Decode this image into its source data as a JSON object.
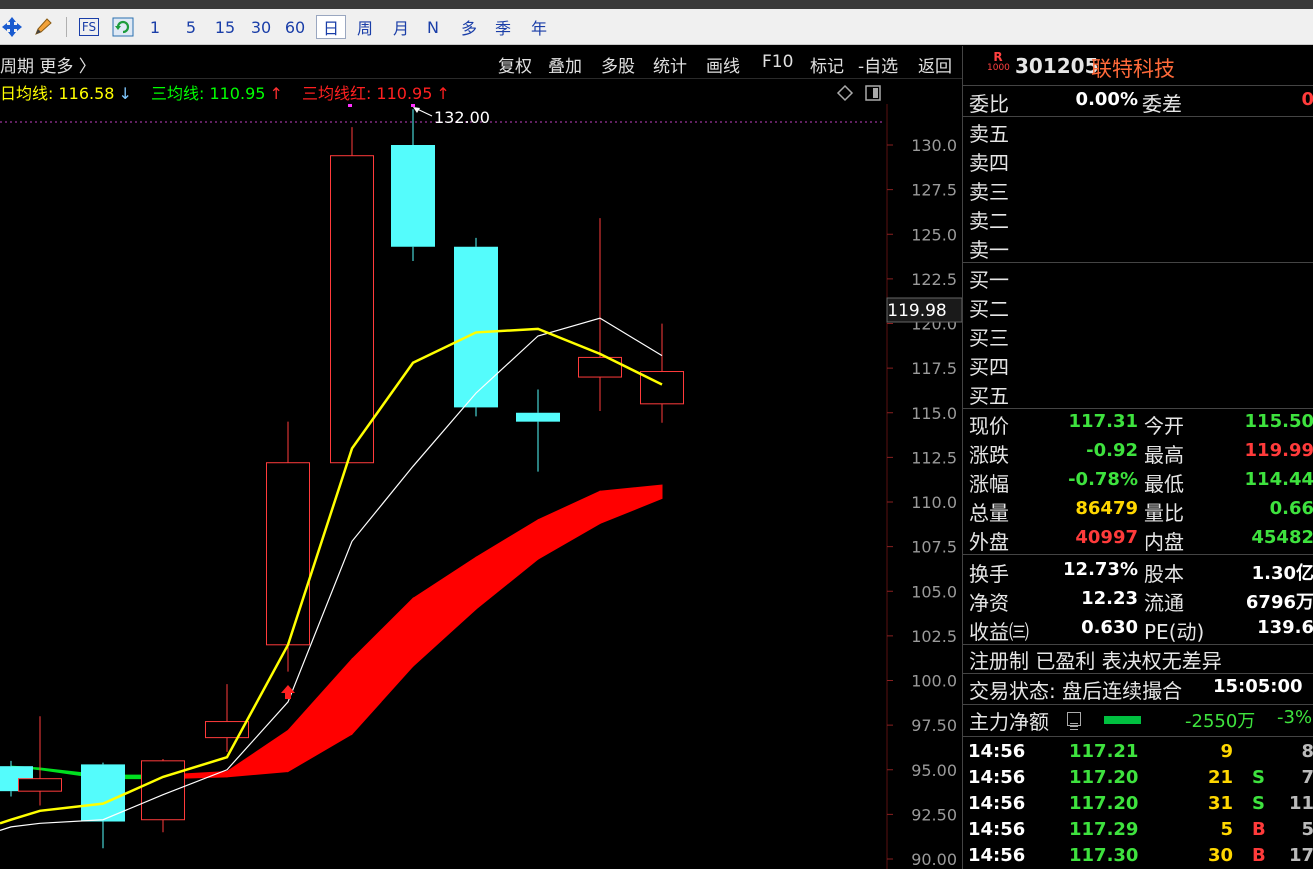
{
  "toolbar": {
    "periods": [
      "1",
      "5",
      "15",
      "30",
      "60",
      "日",
      "周",
      "月",
      "N",
      "多",
      "季",
      "年"
    ],
    "active_period": "日",
    "fs_label": "FS"
  },
  "chart_header": {
    "left_label": "周期  更多 〉",
    "menu": [
      "复权",
      "叠加",
      "多股",
      "统计",
      "画线",
      "F10",
      "标记",
      "-自选",
      "返回"
    ]
  },
  "legend": {
    "ma5": "日均线: 116.58",
    "ma5_arrow": "↓",
    "ma3": "三均线: 110.95",
    "ma3_arrow": "↑",
    "ma3_red": "三均线红: 110.95",
    "ma3_red_arrow": "↑",
    "ma5_color": "#ffff00",
    "ma3_color": "#00ff00",
    "ma3_red_color": "#ff2020"
  },
  "chart_data": {
    "type": "candlestick",
    "y_axis_ticks": [
      "130.0",
      "127.5",
      "125.0",
      "122.5",
      "120.0",
      "117.5",
      "115.0",
      "112.5",
      "110.0",
      "107.5",
      "105.0",
      "102.5",
      "100.0",
      "97.50",
      "95.00",
      "92.50",
      "90.00"
    ],
    "ylim": [
      90,
      132.5
    ],
    "current_price_label": "119.98",
    "high_marker_label": "132.00",
    "candles": [
      {
        "open": 95.2,
        "high": 95.5,
        "low": 93.5,
        "close": 93.8
      },
      {
        "open": 93.8,
        "high": 98.0,
        "low": 93.0,
        "close": 94.5
      },
      {
        "open": 95.3,
        "high": 95.4,
        "low": 90.6,
        "close": 92.1
      },
      {
        "open": 92.2,
        "high": 95.6,
        "low": 91.5,
        "close": 95.5
      },
      {
        "open": 96.8,
        "high": 99.8,
        "low": 96.0,
        "close": 97.7
      },
      {
        "open": 102.0,
        "high": 114.5,
        "low": 100.5,
        "close": 112.2
      },
      {
        "open": 112.2,
        "high": 131.0,
        "low": 112.2,
        "close": 129.4
      },
      {
        "open": 130.0,
        "high": 132.0,
        "low": 123.5,
        "close": 124.3
      },
      {
        "open": 124.3,
        "high": 124.8,
        "low": 114.8,
        "close": 115.3
      },
      {
        "open": 115.0,
        "high": 116.3,
        "low": 111.7,
        "close": 114.5
      },
      {
        "open": 117.0,
        "high": 125.9,
        "low": 115.1,
        "close": 118.1
      },
      {
        "open": 115.5,
        "high": 119.99,
        "low": 114.44,
        "close": 117.31
      }
    ],
    "ma_yellow": [
      92.2,
      92.7,
      93.1,
      94.6,
      95.7,
      102.0,
      113.0,
      117.8,
      119.5,
      119.7,
      118.3,
      116.58
    ],
    "ma_white": [
      91.8,
      92.0,
      92.2,
      93.6,
      95.0,
      98.8,
      107.8,
      112.0,
      116.1,
      119.3,
      120.3,
      118.2
    ],
    "band_upper": [
      95.2,
      95.1,
      94.7,
      94.7,
      94.9,
      97.2,
      101.2,
      104.6,
      106.9,
      109.0,
      110.6,
      110.95
    ],
    "band_lower": [
      95.2,
      95.0,
      94.5,
      94.5,
      94.6,
      94.9,
      97.0,
      100.8,
      104.0,
      106.8,
      108.8,
      110.2
    ],
    "band_colors": [
      "green",
      "green",
      "green",
      "red",
      "red",
      "red",
      "red",
      "red",
      "red",
      "red",
      "red",
      "red"
    ],
    "grid": false
  },
  "stock": {
    "code": "301205",
    "name": "联特科技",
    "badge_top": "R",
    "badge_bottom": "1000"
  },
  "quote": {
    "weibi_label": "委比",
    "weibi_value": "0.00%",
    "weicha_label": "委差",
    "weicha_value": "0",
    "sell_levels": [
      "卖五",
      "卖四",
      "卖三",
      "卖二",
      "卖一"
    ],
    "buy_levels": [
      "买一",
      "买二",
      "买三",
      "买四",
      "买五"
    ],
    "rows": [
      {
        "l1": "现价",
        "v1": "117.31",
        "c1": "green",
        "l2": "今开",
        "v2": "115.50",
        "c2": "green"
      },
      {
        "l1": "涨跌",
        "v1": "-0.92",
        "c1": "green",
        "l2": "最高",
        "v2": "119.99",
        "c2": "red"
      },
      {
        "l1": "涨幅",
        "v1": "-0.78%",
        "c1": "green",
        "l2": "最低",
        "v2": "114.44",
        "c2": "green"
      },
      {
        "l1": "总量",
        "v1": "86479",
        "c1": "yellow",
        "l2": "量比",
        "v2": "0.66",
        "c2": "green"
      },
      {
        "l1": "外盘",
        "v1": "40997",
        "c1": "red",
        "l2": "内盘",
        "v2": "45482",
        "c2": "green"
      },
      {
        "l1": "换手",
        "v1": "12.73%",
        "c1": "white",
        "l2": "股本",
        "v2": "1.30亿",
        "c2": "white"
      },
      {
        "l1": "净资",
        "v1": "12.23",
        "c1": "white",
        "l2": "流通",
        "v2": "6796万",
        "c2": "white"
      },
      {
        "l1": "收益㈢",
        "v1": "0.630",
        "c1": "white",
        "l2": "PE(动)",
        "v2": "139.6",
        "c2": "white"
      }
    ],
    "registration_line": "注册制 已盈利 表决权无差异",
    "trade_status_label": "交易状态: 盘后连续撮合",
    "trade_status_time": "15:05:00",
    "main_flow_label": "主力净额",
    "main_flow_value": "-2550万",
    "main_flow_pct": "-3%"
  },
  "ticks": [
    {
      "time": "14:56",
      "price": "117.21",
      "vol": "9",
      "bs": "",
      "num": "8"
    },
    {
      "time": "14:56",
      "price": "117.20",
      "vol": "21",
      "bs": "S",
      "num": "7"
    },
    {
      "time": "14:56",
      "price": "117.20",
      "vol": "31",
      "bs": "S",
      "num": "11"
    },
    {
      "time": "14:56",
      "price": "117.29",
      "vol": "5",
      "bs": "B",
      "num": "5"
    },
    {
      "time": "14:56",
      "price": "117.30",
      "vol": "30",
      "bs": "B",
      "num": "17"
    }
  ]
}
